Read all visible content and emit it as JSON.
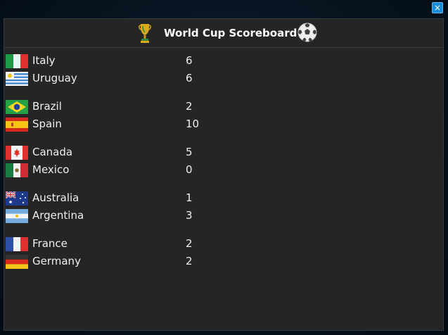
{
  "window": {
    "title": "World Cup Scoreboard",
    "close_label": "×"
  },
  "icons": {
    "title_left": "trophy-icon",
    "title_right": "soccer-ball-icon",
    "close": "close-icon"
  },
  "colors": {
    "background": "#252525",
    "text": "#f0f0f0",
    "close_button": "#1a8cd8"
  },
  "matches": [
    {
      "home": {
        "team": "Italy",
        "score": "6",
        "flag": "flag-italy-icon"
      },
      "away": {
        "team": "Uruguay",
        "score": "6",
        "flag": "flag-uruguay-icon"
      }
    },
    {
      "home": {
        "team": "Brazil",
        "score": "2",
        "flag": "flag-brazil-icon"
      },
      "away": {
        "team": "Spain",
        "score": "10",
        "flag": "flag-spain-icon"
      }
    },
    {
      "home": {
        "team": "Canada",
        "score": "5",
        "flag": "flag-canada-icon"
      },
      "away": {
        "team": "Mexico",
        "score": "0",
        "flag": "flag-mexico-icon"
      }
    },
    {
      "home": {
        "team": "Australia",
        "score": "1",
        "flag": "flag-australia-icon"
      },
      "away": {
        "team": "Argentina",
        "score": "3",
        "flag": "flag-argentina-icon"
      }
    },
    {
      "home": {
        "team": "France",
        "score": "2",
        "flag": "flag-france-icon"
      },
      "away": {
        "team": "Germany",
        "score": "2",
        "flag": "flag-germany-icon"
      }
    }
  ]
}
